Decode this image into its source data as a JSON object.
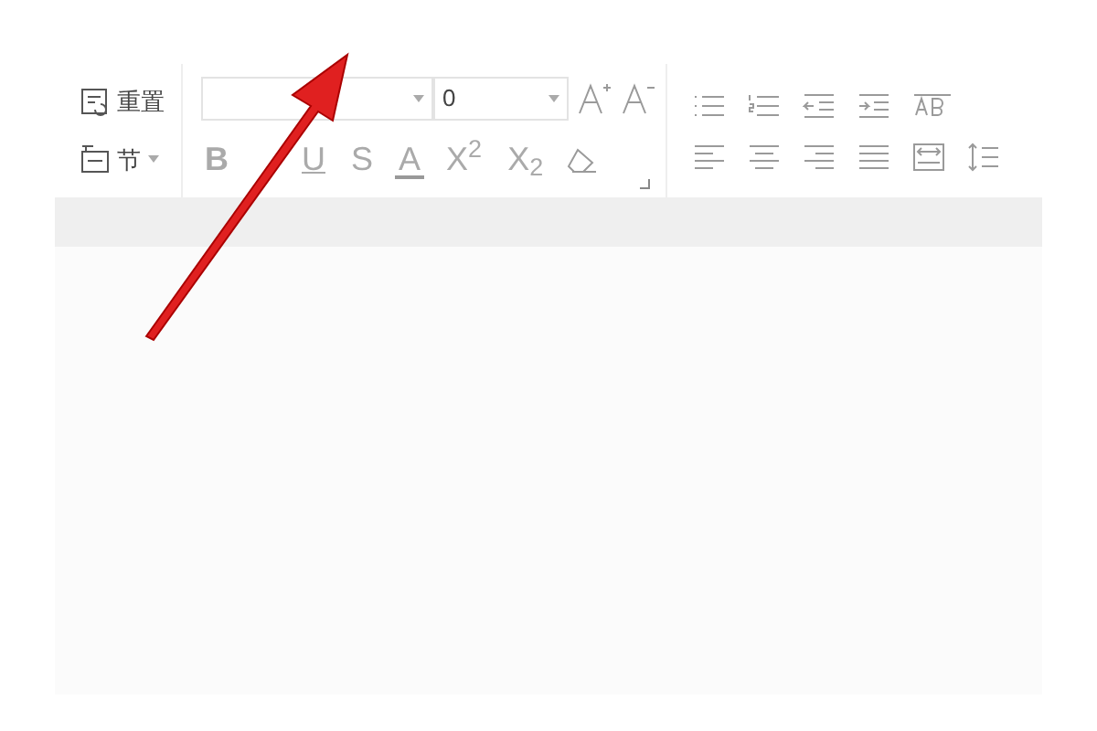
{
  "ribbon": {
    "left_group": [
      {
        "kind": "reset",
        "label": "重置"
      },
      {
        "kind": "section",
        "label": "节"
      }
    ],
    "font_size": {
      "value": "0"
    },
    "format_buttons": [
      {
        "kind": "bold",
        "label": "B"
      },
      {
        "kind": "underline",
        "label": "U"
      },
      {
        "kind": "strike",
        "label": "S"
      },
      {
        "kind": "color",
        "label": "A"
      },
      {
        "kind": "sup",
        "label": "X$^{2}$"
      },
      {
        "kind": "sub",
        "label": "X$_{2}$"
      }
    ]
  }
}
